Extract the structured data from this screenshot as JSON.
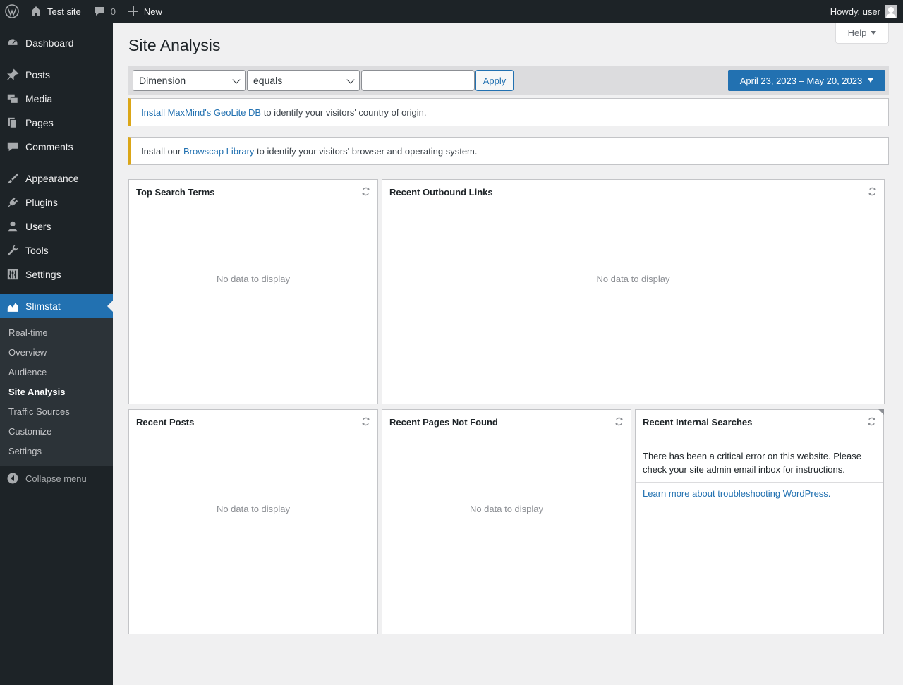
{
  "admin_bar": {
    "site_name": "Test site",
    "comment_count": "0",
    "new_label": "New",
    "howdy": "Howdy, user"
  },
  "sidebar": {
    "items": [
      {
        "label": "Dashboard",
        "icon": "dashboard-icon"
      },
      {
        "label": "Posts",
        "icon": "pin-icon"
      },
      {
        "label": "Media",
        "icon": "media-icon"
      },
      {
        "label": "Pages",
        "icon": "pages-icon"
      },
      {
        "label": "Comments",
        "icon": "comment-icon"
      },
      {
        "label": "Appearance",
        "icon": "brush-icon"
      },
      {
        "label": "Plugins",
        "icon": "plug-icon"
      },
      {
        "label": "Users",
        "icon": "user-icon"
      },
      {
        "label": "Tools",
        "icon": "wrench-icon"
      },
      {
        "label": "Settings",
        "icon": "sliders-icon"
      },
      {
        "label": "Slimstat",
        "icon": "chart-area-icon"
      }
    ],
    "submenu": [
      "Real-time",
      "Overview",
      "Audience",
      "Site Analysis",
      "Traffic Sources",
      "Customize",
      "Settings"
    ],
    "collapse_label": "Collapse menu"
  },
  "main": {
    "help_label": "Help",
    "title": "Site Analysis",
    "filter": {
      "dimension": "Dimension",
      "operator": "equals",
      "value": "",
      "apply_label": "Apply",
      "date_range": "April 23, 2023 – May 20, 2023"
    },
    "notices": [
      {
        "link": "Install MaxMind's GeoLite DB",
        "prefix": "",
        "suffix": " to identify your visitors' country of origin."
      },
      {
        "prefix": "Install our ",
        "link": "Browscap Library",
        "suffix": " to identify your visitors' browser and operating system."
      }
    ],
    "boxes": {
      "top_search_terms": {
        "title": "Top Search Terms",
        "empty": "No data to display"
      },
      "recent_outbound_links": {
        "title": "Recent Outbound Links",
        "empty": "No data to display"
      },
      "recent_posts": {
        "title": "Recent Posts",
        "empty": "No data to display"
      },
      "recent_pages_not_found": {
        "title": "Recent Pages Not Found",
        "empty": "No data to display"
      },
      "recent_internal_searches": {
        "title": "Recent Internal Searches",
        "error": "There has been a critical error on this website. Please check your site admin email inbox for instructions.",
        "link": "Learn more about troubleshooting WordPress."
      }
    }
  },
  "colors": {
    "accent": "#2271b1",
    "sidebar": "#1d2327",
    "notice": "#dba617"
  }
}
